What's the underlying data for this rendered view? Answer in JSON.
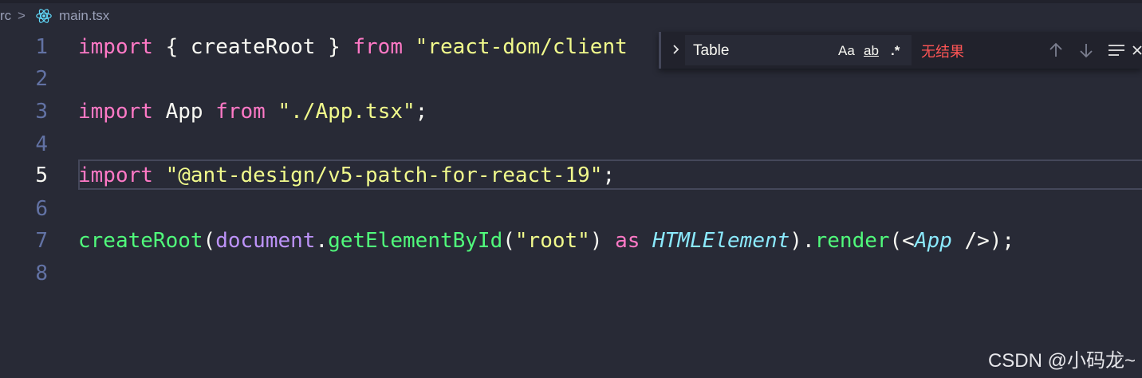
{
  "breadcrumb": {
    "folder": "rc",
    "separator": ">",
    "file": "main.tsx",
    "file_icon": "react-icon"
  },
  "gutter": {
    "line_numbers": [
      "1",
      "2",
      "3",
      "4",
      "5",
      "6",
      "7",
      "8"
    ],
    "active_line": "5"
  },
  "code": {
    "line1": {
      "kw_import": "import",
      "p1": " { createRoot } ",
      "kw_from": "from",
      "p2": " ",
      "str": "\"react-dom/client"
    },
    "line3": {
      "kw_import": "import",
      "p1": " App ",
      "kw_from": "from",
      "p2": " ",
      "str": "\"./App.tsx\"",
      "p3": ";"
    },
    "line5": {
      "kw_import": "import",
      "p1": " ",
      "str": "\"@ant-design/v5-patch-for-react-19\"",
      "p2": ";"
    },
    "line7": {
      "fn1": "createRoot",
      "p1": "(",
      "var": "document",
      "p2": ".",
      "fn2": "getElementById",
      "p3": "(",
      "str": "\"root\"",
      "p4": ") ",
      "kw_as": "as",
      "p5": " ",
      "type1": "HTMLElement",
      "p6": ").",
      "fn3": "render",
      "p7": "(<",
      "type2": "App",
      "p8": " />);"
    }
  },
  "find_widget": {
    "query": "Table",
    "match_case_label": "Aa",
    "whole_word_label": "ab",
    "regex_label": ".*",
    "result_text": "无结果",
    "icons": [
      "chevron-right-icon",
      "arrow-up-icon",
      "arrow-down-icon",
      "find-in-selection-icon",
      "close-icon"
    ]
  },
  "watermark": "CSDN @小码龙~",
  "colors": {
    "background": "#282a36",
    "keyword": "#ff79c6",
    "string": "#f1fa8c",
    "function": "#50fa7b",
    "variable": "#bd93f9",
    "type": "#8be9fd",
    "no_result": "#ff5555"
  }
}
